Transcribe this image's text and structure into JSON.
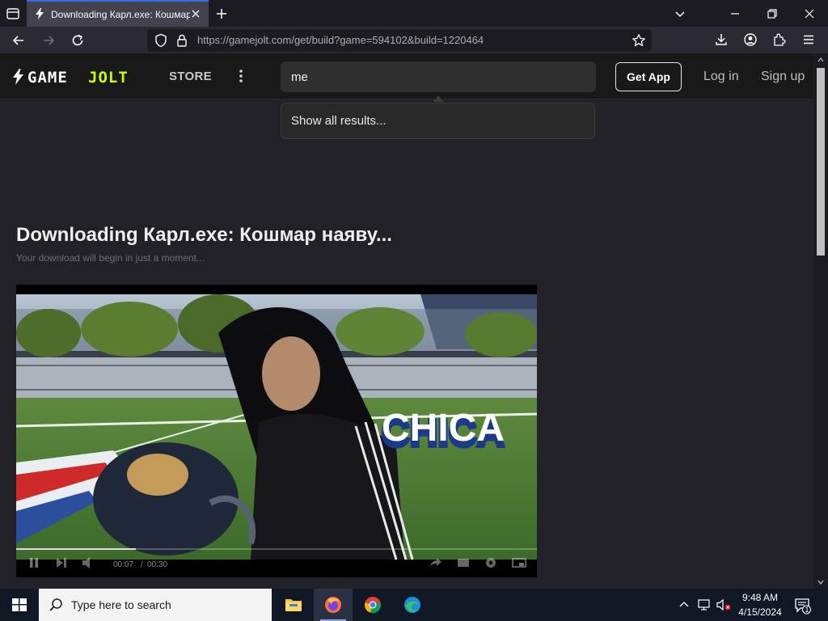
{
  "browser": {
    "tab_title": "Downloading Карл.exe: Кошмар наяву...",
    "url_host": "https://gamejolt.com",
    "url_path": "/get/build?game=594102&build=1220464"
  },
  "header": {
    "logo_text": "GAME JOLT",
    "store_label": "STORE",
    "search_value": "me",
    "get_app_label": "Get App",
    "login_label": "Log in",
    "signup_label": "Sign up"
  },
  "search_dropdown": {
    "show_all_label": "Show all results..."
  },
  "page": {
    "title": "Downloading Карл.exe: Кошмар наяву...",
    "subtitle": "Your download will begin in just a moment..."
  },
  "video": {
    "caption_text": "CHICA",
    "current_time": "00:07",
    "separator": "/",
    "duration": "00:30",
    "progress_fraction": 0.23
  },
  "taskbar": {
    "search_placeholder": "Type here to search",
    "time": "9:48 AM",
    "date": "4/15/2024",
    "notification_count": "1"
  },
  "colors": {
    "browser_accent": "#2f70e6",
    "gj_logo_green": "#ccff00",
    "page_bg": "#232128",
    "header_bg": "#191919"
  },
  "icons": [
    "tab-list-icon",
    "gamejolt-bolt-icon",
    "close-tab-icon",
    "new-tab-icon",
    "chevron-down-icon",
    "minimize-icon",
    "restore-icon",
    "close-window-icon",
    "back-icon",
    "forward-icon",
    "reload-icon",
    "shield-icon",
    "lock-icon",
    "star-icon",
    "download-icon",
    "account-icon",
    "extensions-icon",
    "hamburger-menu-icon",
    "more-vertical-icon",
    "windows-logo-icon",
    "search-icon",
    "file-explorer-icon",
    "firefox-icon",
    "chrome-icon",
    "edge-icon",
    "chevron-up-icon",
    "network-icon",
    "volume-muted-icon",
    "notifications-icon"
  ]
}
